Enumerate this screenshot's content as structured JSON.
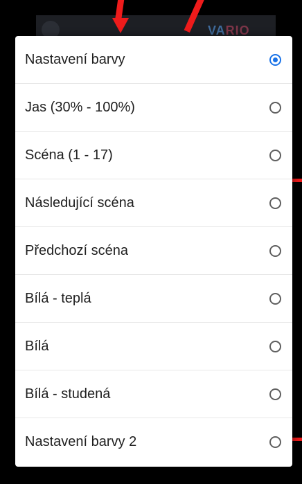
{
  "background": {
    "logo_text": "VA",
    "logo_accent": "RIO"
  },
  "dialog": {
    "options": [
      {
        "label": "Nastavení barvy",
        "checked": true
      },
      {
        "label": "Jas (30% - 100%)",
        "checked": false
      },
      {
        "label": "Scéna (1 - 17)",
        "checked": false
      },
      {
        "label": "Následující scéna",
        "checked": false
      },
      {
        "label": "Předchozí scéna",
        "checked": false
      },
      {
        "label": "Bílá - teplá",
        "checked": false
      },
      {
        "label": "Bílá",
        "checked": false
      },
      {
        "label": "Bílá - studená",
        "checked": false
      },
      {
        "label": "Nastavení barvy 2",
        "checked": false
      }
    ]
  },
  "colors": {
    "accent": "#1a73e8",
    "annotation": "#ee1b1b",
    "dialog_bg": "#ffffff",
    "backdrop": "#000000"
  }
}
